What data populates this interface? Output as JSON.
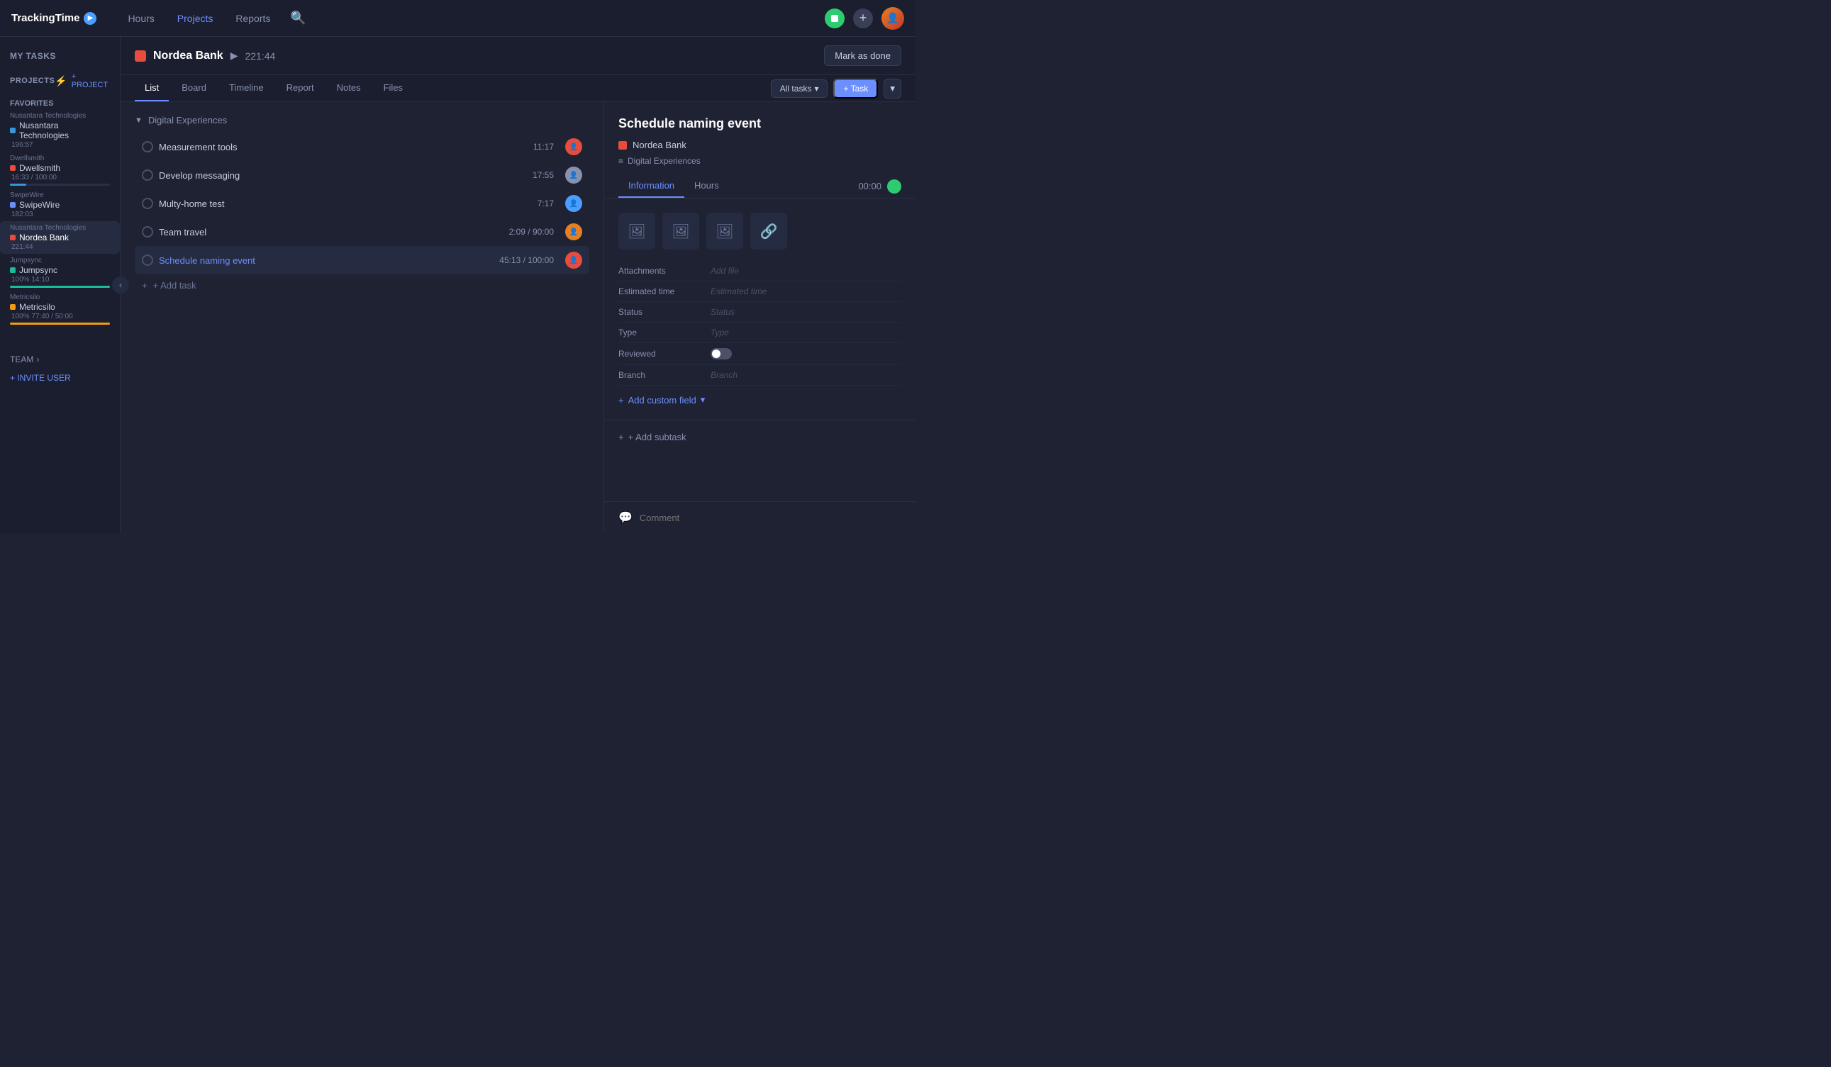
{
  "app": {
    "logo": "TrackingTime",
    "logo_symbol": "▶"
  },
  "nav": {
    "links": [
      {
        "label": "Hours",
        "active": false
      },
      {
        "label": "Projects",
        "active": true
      },
      {
        "label": "Reports",
        "active": false
      }
    ],
    "search_placeholder": "Search"
  },
  "sidebar": {
    "my_tasks_label": "MY TASKS",
    "projects_label": "PROJECTS",
    "add_project_label": "+ PROJECT",
    "favorites_label": "FAVORITES",
    "projects": [
      {
        "company": "Nusantara Technologies",
        "name": "Nusantara Technologies",
        "time": "196:57",
        "dot_color": "#6c8fff",
        "active": false,
        "progress": null
      },
      {
        "company": "Dwellsmith",
        "name": "Dwellsmith",
        "time": "16:33 / 100:00",
        "dot_color": "#e74c3c",
        "active": false,
        "progress": 16,
        "progress_color": "#3498db"
      },
      {
        "company": "SwipeWire",
        "name": "SwipeWire",
        "time": "182:03",
        "dot_color": "#3498db",
        "active": false,
        "progress": null
      },
      {
        "company": "Nusantara Technologies",
        "name": "Nordea Bank",
        "time": "221:44",
        "dot_color": "#e74c3c",
        "active": true,
        "progress": null
      },
      {
        "company": "Jumpsync",
        "name": "Jumpsync",
        "time": "100% 14:10",
        "dot_color": "#1abc9c",
        "active": false,
        "progress": 100,
        "progress_color": "#1abc9c"
      },
      {
        "company": "Metricsilo",
        "name": "Metricsilo",
        "time": "100% 77:40 / 50:00",
        "dot_color": "#f39c12",
        "active": false,
        "progress": 100,
        "progress_color": "#f39c12"
      }
    ],
    "team_label": "TEAM",
    "invite_user_label": "+ INVITE USER"
  },
  "project_header": {
    "name": "Nordea Bank",
    "time": "221:44",
    "mark_done_label": "Mark as done"
  },
  "tabs": {
    "items": [
      {
        "label": "List",
        "active": true
      },
      {
        "label": "Board",
        "active": false
      },
      {
        "label": "Timeline",
        "active": false
      },
      {
        "label": "Report",
        "active": false
      },
      {
        "label": "Notes",
        "active": false
      },
      {
        "label": "Files",
        "active": false
      }
    ],
    "all_tasks_label": "All tasks",
    "add_task_label": "+ Task",
    "more_label": "▾"
  },
  "task_list": {
    "group_name": "Digital Experiences",
    "tasks": [
      {
        "name": "Measurement tools",
        "time": "11:17",
        "avatar_color": "#e74c3c",
        "active": false
      },
      {
        "name": "Develop messaging",
        "time": "17:55",
        "avatar_color": "#8891b0",
        "active": false
      },
      {
        "name": "Multy-home test",
        "time": "7:17",
        "avatar_color": "#4a9eff",
        "active": false
      },
      {
        "name": "Team travel",
        "time": "2:09 / 90:00",
        "avatar_color": "#e67e22",
        "active": false
      },
      {
        "name": "Schedule naming event",
        "time": "45:13 / 100:00",
        "avatar_color": "#e74c3c",
        "active": true
      }
    ],
    "add_task_label": "+ Add task"
  },
  "right_panel": {
    "task_title": "Schedule naming event",
    "project_name": "Nordea Bank",
    "breadcrumb": "Digital Experiences",
    "detail_tabs": [
      {
        "label": "Information",
        "active": true
      },
      {
        "label": "Hours",
        "active": false
      }
    ],
    "timer_value": "00:00",
    "fields": [
      {
        "label": "Attachments",
        "value": "Add file",
        "type": "link"
      },
      {
        "label": "Estimated time",
        "value": "Estimated time",
        "type": "italic"
      },
      {
        "label": "Status",
        "value": "Status",
        "type": "italic"
      },
      {
        "label": "Type",
        "value": "Type",
        "type": "italic"
      },
      {
        "label": "Reviewed",
        "value": "",
        "type": "toggle"
      },
      {
        "label": "Branch",
        "value": "Branch",
        "type": "italic"
      }
    ],
    "add_custom_field_label": "Add custom field",
    "add_subtask_label": "+ Add subtask",
    "comment_placeholder": "Comment"
  }
}
